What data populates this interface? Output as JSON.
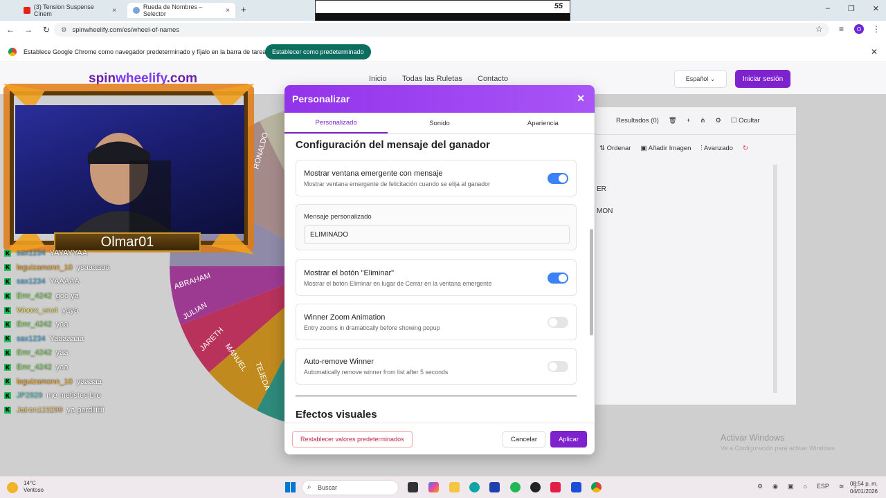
{
  "browser": {
    "tabs": [
      {
        "title": "(3) Tension Suspense Cinem"
      },
      {
        "title": "Rueda de Nombres – Selector"
      }
    ],
    "new_tab": "+",
    "url": "spinwheelify.com/es/wheel-of-names",
    "infobar": {
      "message": "Establece Google Chrome como navegador predeterminado y fíjalo en la barra de tareas",
      "button": "Establecer como predeterminado"
    }
  },
  "sticker": {
    "number": "55"
  },
  "site": {
    "logo_a": "spin",
    "logo_b": "wheelify",
    "logo_c": ".com",
    "nav": [
      "Inicio",
      "Todas las Ruletas",
      "Contacto"
    ],
    "language": "Español",
    "login": "Iniciar sesión",
    "results": "Resultados (0)",
    "hide": "Ocultar",
    "sort": "Ordenar",
    "add_image": "Añadir Imagen",
    "advanced": "Avanzado",
    "list_fragments": [
      "ER",
      "MON"
    ]
  },
  "wheel": {
    "names": [
      "RONALDO",
      "ABRAHAM",
      "JULIAN",
      "JARETH",
      "MANUEL",
      "TEJEDA"
    ]
  },
  "stream": {
    "nameplate": "Olmar01",
    "chat": [
      {
        "user": "sax1234",
        "msg": "YAYAYYAA",
        "color": "#4fb4e8"
      },
      {
        "user": "leguizamonn_10",
        "msg": "ysaaaaaa",
        "color": "#f5a623"
      },
      {
        "user": "sax1234",
        "msg": "YAAAAA",
        "color": "#4fb4e8"
      },
      {
        "user": "Emr_4242",
        "msg": "goo ya",
        "color": "#7ed957"
      },
      {
        "user": "Woorx_uru4",
        "msg": "yaya",
        "color": "#f2e25c"
      },
      {
        "user": "Emr_4242",
        "msg": "yaa",
        "color": "#7ed957"
      },
      {
        "user": "sax1234",
        "msg": "Yaaaaaaa",
        "color": "#4fb4e8"
      },
      {
        "user": "Emr_4242",
        "msg": "yaa",
        "color": "#7ed957"
      },
      {
        "user": "Emr_4242",
        "msg": "yaa",
        "color": "#7ed957"
      },
      {
        "user": "leguizamonn_10",
        "msg": "yaaaaa",
        "color": "#f5a623"
      },
      {
        "user": "JP2929",
        "msg": "me metistes bro",
        "color": "#5ad1c8"
      },
      {
        "user": "Jairon123299",
        "msg": "ya perdiiiiiii",
        "color": "#f7c86b"
      }
    ]
  },
  "modal": {
    "title": "Personalizar",
    "tabs": [
      "Personalizado",
      "Sonido",
      "Apariencia"
    ],
    "section1": "Configuración del mensaje del ganador",
    "popup": {
      "title": "Mostrar ventana emergente con mensaje",
      "desc": "Mostrar ventana emergente de felicitación cuando se elija al ganador",
      "on": true
    },
    "custom_message": {
      "label": "Mensaje personalizado",
      "value": "ELIMINADO"
    },
    "remove_button": {
      "title": "Mostrar el botón \"Eliminar\"",
      "desc": "Mostrar el botón Eliminar en lugar de Cerrar en la ventana emergente",
      "on": true
    },
    "zoom": {
      "title": "Winner Zoom Animation",
      "desc": "Entry zooms in dramatically before showing popup",
      "on": false
    },
    "autoremove": {
      "title": "Auto-remove Winner",
      "desc": "Automatically remove winner from list after 5 seconds",
      "on": false
    },
    "section2": "Efectos visuales",
    "reset": "Restablecer valores predeterminados",
    "cancel": "Cancelar",
    "apply": "Aplicar"
  },
  "windows": {
    "activate_title": "Activar Windows",
    "activate_desc": "Ve a Configuración para activar Windows."
  },
  "taskbar": {
    "temp": "14°C",
    "weather": "Ventoso",
    "search": "Buscar",
    "lang": "ESP",
    "time": "08:54 p. m.",
    "date": "04/01/2026"
  },
  "colors": {
    "accent": "#7e22ce",
    "toggle_on": "#3b82f6",
    "infobar_button": "#0b6e5f"
  }
}
